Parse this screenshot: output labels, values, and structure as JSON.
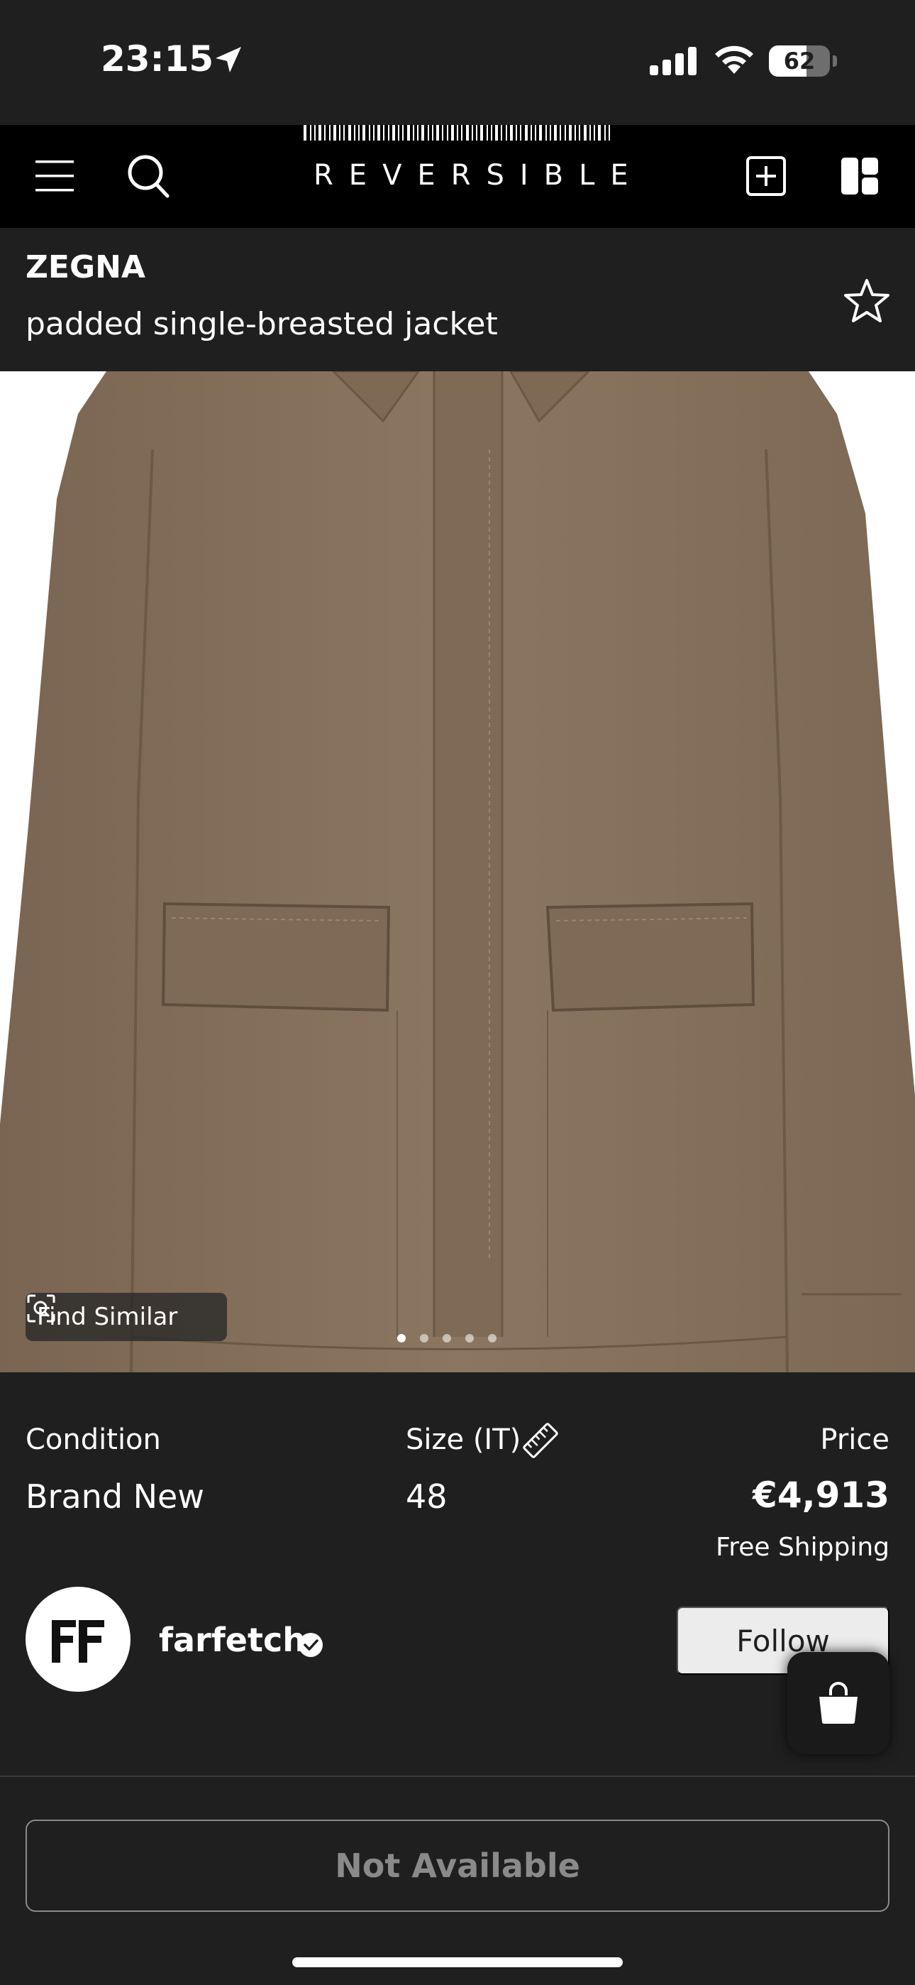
{
  "status_bar": {
    "time": "23:15",
    "battery": "62",
    "battery_level": 0.62
  },
  "nav": {
    "logo_text": "REVERSIBLE",
    "icons": [
      "menu-icon",
      "search-icon",
      "add-square-icon",
      "layout-icon"
    ]
  },
  "product": {
    "brand": "ZEGNA",
    "name": "padded single-breasted jacket",
    "find_similar": "Find Similar",
    "image_count": 5,
    "active_image": 1
  },
  "details": {
    "condition_label": "Condition",
    "condition_value": "Brand New",
    "size_label": "Size (IT)",
    "size_value": "48",
    "price_label": "Price",
    "price_value": "€4,913",
    "shipping": "Free Shipping"
  },
  "seller": {
    "name": "farfetch",
    "verified": true,
    "follow_label": "Follow"
  },
  "footer": {
    "action_label": "Not Available"
  },
  "colors": {
    "background": "#1f1f1f",
    "nav_background": "#000000",
    "jacket": "#8a7560",
    "disabled_text": "#8a8a8a"
  }
}
